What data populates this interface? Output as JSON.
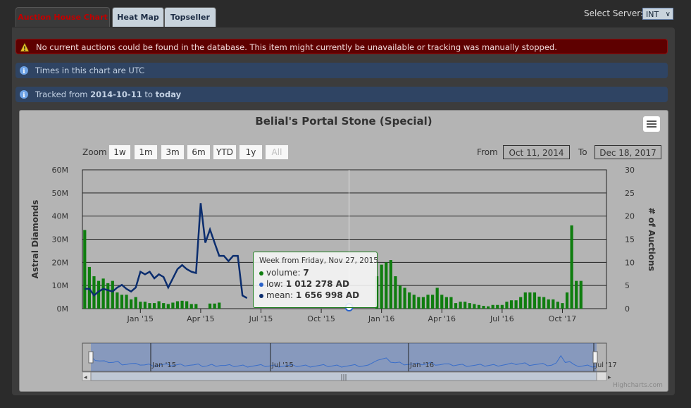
{
  "tabs": [
    {
      "label": "Auction House Chart"
    },
    {
      "label": "Heat Map"
    },
    {
      "label": "Topseller"
    }
  ],
  "server": {
    "label": "Select Server:",
    "value": "INT"
  },
  "alerts": {
    "error": "No current auctions could be found in the database. This item might currently be unavailable or tracking was manually stopped.",
    "utc": "Times in this chart are UTC",
    "tracked_prefix": "Tracked from ",
    "tracked_date": "2014-10-11",
    "tracked_to": " to ",
    "tracked_end": "today"
  },
  "zoom": {
    "label": "Zoom",
    "buttons": [
      "1w",
      "1m",
      "3m",
      "6m",
      "YTD",
      "1y",
      "All"
    ],
    "selected": "All"
  },
  "range": {
    "from_label": "From",
    "from": "Oct 11, 2014",
    "to_label": "To",
    "to": "Dec 18, 2017"
  },
  "tooltip": {
    "header": "Week from Friday, Nov 27, 2015",
    "volume_label": "volume: ",
    "volume": "7",
    "low_label": "low: ",
    "low": "1 012 278 AD",
    "mean_label": "mean: ",
    "mean": "1 656 998 AD"
  },
  "credits": "Highcharts.com",
  "navigator": {
    "labels": [
      "Jan '15",
      "Jul '15",
      "Jan '16",
      "Jul '17"
    ]
  },
  "colors": {
    "volume": "#0f7d0f",
    "mean": "#0b2d6e",
    "low": "#2a62c9",
    "accent": "#c00000"
  },
  "chart_data": {
    "type": "line",
    "title": "Belial's Portal Stone (Special)",
    "ylabel": "Astral Diamonds",
    "y2label": "# of Auctions",
    "y_ticks": [
      "0M",
      "10M",
      "20M",
      "30M",
      "40M",
      "50M",
      "60M"
    ],
    "y2_ticks": [
      "0",
      "5",
      "10",
      "15",
      "20",
      "25",
      "30"
    ],
    "ylim": [
      0,
      60000000
    ],
    "y2lim": [
      0,
      30
    ],
    "x_ticks": [
      "Jan '15",
      "Apr '15",
      "Jul '15",
      "Oct '15",
      "Jan '16",
      "Apr '16",
      "Jul '16",
      "Oct '17"
    ],
    "x_tick_weeks": [
      12,
      25,
      38,
      51,
      64,
      77,
      90,
      103
    ],
    "xlim": [
      0,
      113
    ],
    "series": [
      {
        "name": "volume",
        "type": "column",
        "axis": "right",
        "values": [
          17,
          9,
          7,
          6,
          6.5,
          5.5,
          6,
          3.5,
          3,
          3,
          2,
          2.5,
          1.5,
          1.5,
          1.2,
          1.2,
          1.6,
          1.2,
          1,
          1.3,
          1.6,
          1.7,
          1.6,
          1,
          1,
          0,
          0,
          1.1,
          1.1,
          1.3,
          0,
          0,
          0,
          0,
          0,
          0,
          0,
          0,
          0,
          0,
          0,
          0,
          0,
          0,
          0,
          0,
          0,
          0,
          0,
          0,
          0,
          0,
          0,
          0,
          0,
          0,
          0,
          0,
          0,
          0,
          0,
          0,
          0,
          7,
          9.5,
          10,
          10.5,
          7,
          5,
          4.5,
          3.5,
          3,
          2.5,
          2.5,
          3,
          3,
          4.5,
          3,
          2.5,
          2.5,
          1.2,
          1.5,
          1.5,
          1.2,
          1,
          0.8,
          0.6,
          0.5,
          0.8,
          0.8,
          0.8,
          1.5,
          1.8,
          1.8,
          2.5,
          3.5,
          3.5,
          3.5,
          2.6,
          2.5,
          2,
          2,
          1.5,
          1.2,
          3.5,
          18,
          6,
          6
        ]
      },
      {
        "name": "mean",
        "type": "line",
        "axis": "left",
        "values": [
          1.5,
          1.5,
          1.0,
          1.3,
          1.5,
          1.4,
          1.3,
          1.6,
          1.8,
          1.5,
          1.3,
          1.6,
          2.8,
          2.6,
          2.8,
          2.3,
          2.6,
          2.4,
          1.6,
          2.3,
          3.0,
          3.3,
          3.0,
          2.8,
          2.7,
          8.0,
          5.0,
          6.0,
          5.0,
          4.0,
          4.0,
          3.6,
          4.0,
          4.0,
          1.0,
          0.8,
          null,
          null,
          null,
          null,
          null,
          null,
          null,
          null,
          null,
          null,
          null,
          null,
          null,
          null,
          null,
          null,
          null,
          null,
          null,
          null,
          null,
          null,
          null,
          null,
          null,
          null,
          null,
          null,
          null,
          null,
          null,
          null,
          null,
          null,
          null,
          null,
          null,
          null,
          null,
          null,
          null,
          null,
          null,
          null,
          null,
          null,
          null,
          null,
          null,
          null,
          null,
          null,
          null,
          null,
          null,
          null,
          null,
          null,
          null,
          null,
          null,
          null,
          null,
          null,
          null,
          null,
          null,
          null,
          null,
          null,
          null,
          null,
          null,
          null,
          null,
          null,
          null,
          null
        ],
        "note": "unitless scale placeholder"
      }
    ]
  }
}
